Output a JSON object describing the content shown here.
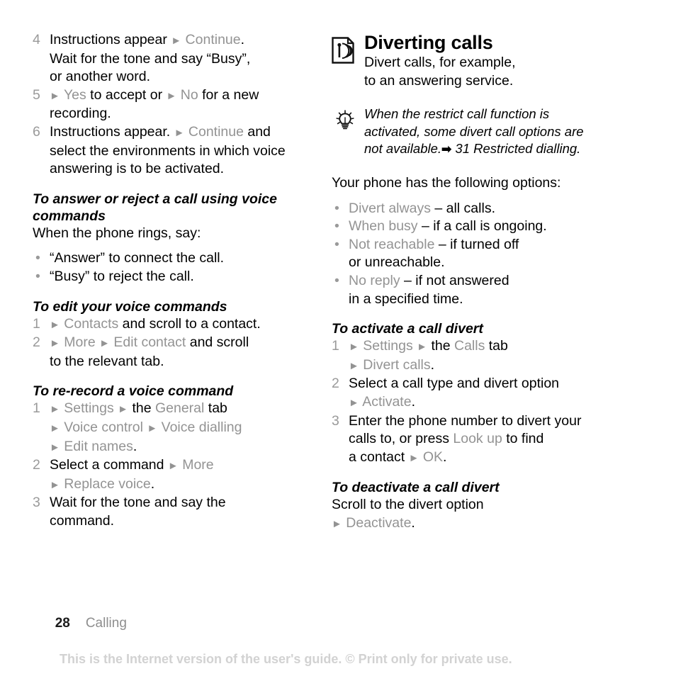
{
  "left_column": {
    "steps_top": [
      {
        "num": "4",
        "lines": [
          {
            "segments": [
              {
                "t": "Instructions appear ",
                "s": "plain"
              },
              {
                "t": "►",
                "s": "arrow"
              },
              {
                "t": " ",
                "s": "plain"
              },
              {
                "t": "Continue",
                "s": "ui"
              },
              {
                "t": ".",
                "s": "plain"
              }
            ]
          },
          {
            "segments": [
              {
                "t": "Wait for the tone and say “Busy”,",
                "s": "plain"
              }
            ]
          },
          {
            "segments": [
              {
                "t": "or another word.",
                "s": "plain"
              }
            ]
          }
        ]
      },
      {
        "num": "5",
        "lines": [
          {
            "segments": [
              {
                "t": "►",
                "s": "arrow"
              },
              {
                "t": " ",
                "s": "plain"
              },
              {
                "t": "Yes",
                "s": "ui"
              },
              {
                "t": " to accept or ",
                "s": "plain"
              },
              {
                "t": "►",
                "s": "arrow"
              },
              {
                "t": " ",
                "s": "plain"
              },
              {
                "t": "No",
                "s": "ui"
              },
              {
                "t": " for a new",
                "s": "plain"
              }
            ]
          },
          {
            "segments": [
              {
                "t": "recording.",
                "s": "plain"
              }
            ]
          }
        ]
      },
      {
        "num": "6",
        "lines": [
          {
            "segments": [
              {
                "t": "Instructions appear. ",
                "s": "plain"
              },
              {
                "t": "►",
                "s": "arrow"
              },
              {
                "t": " ",
                "s": "plain"
              },
              {
                "t": "Continue",
                "s": "ui"
              },
              {
                "t": " and",
                "s": "plain"
              }
            ]
          },
          {
            "segments": [
              {
                "t": "select the environments in which voice",
                "s": "plain"
              }
            ]
          },
          {
            "segments": [
              {
                "t": "answering is to be activated.",
                "s": "plain"
              }
            ]
          }
        ]
      }
    ],
    "heading_answer_reject": "To answer or reject a call using voice commands",
    "intro_rings": "When the phone rings, say:",
    "bullets_voice": [
      {
        "lines": [
          {
            "segments": [
              {
                "t": "“Answer” to connect the call.",
                "s": "plain"
              }
            ]
          }
        ]
      },
      {
        "lines": [
          {
            "segments": [
              {
                "t": "“Busy” to reject the call.",
                "s": "plain"
              }
            ]
          }
        ]
      }
    ],
    "heading_edit_commands": "To edit your voice commands",
    "steps_edit": [
      {
        "num": "1",
        "lines": [
          {
            "segments": [
              {
                "t": "►",
                "s": "arrow"
              },
              {
                "t": " ",
                "s": "plain"
              },
              {
                "t": "Contacts",
                "s": "ui"
              },
              {
                "t": " and scroll to a contact.",
                "s": "plain"
              }
            ]
          }
        ]
      },
      {
        "num": "2",
        "lines": [
          {
            "segments": [
              {
                "t": "►",
                "s": "arrow"
              },
              {
                "t": " ",
                "s": "plain"
              },
              {
                "t": "More",
                "s": "ui"
              },
              {
                "t": " ",
                "s": "plain"
              },
              {
                "t": "►",
                "s": "arrow"
              },
              {
                "t": " ",
                "s": "plain"
              },
              {
                "t": "Edit contact",
                "s": "ui"
              },
              {
                "t": " and scroll",
                "s": "plain"
              }
            ]
          },
          {
            "segments": [
              {
                "t": "to the relevant tab.",
                "s": "plain"
              }
            ]
          }
        ]
      }
    ],
    "heading_rerecord": "To re-record a voice command",
    "steps_rerecord": [
      {
        "num": "1",
        "lines": [
          {
            "segments": [
              {
                "t": "►",
                "s": "arrow"
              },
              {
                "t": " ",
                "s": "plain"
              },
              {
                "t": "Settings",
                "s": "ui"
              },
              {
                "t": " ",
                "s": "plain"
              },
              {
                "t": "►",
                "s": "arrow"
              },
              {
                "t": " the ",
                "s": "plain"
              },
              {
                "t": "General",
                "s": "ui"
              },
              {
                "t": " tab",
                "s": "plain"
              }
            ]
          },
          {
            "segments": [
              {
                "t": "►",
                "s": "arrow"
              },
              {
                "t": " ",
                "s": "plain"
              },
              {
                "t": "Voice control",
                "s": "ui"
              },
              {
                "t": " ",
                "s": "plain"
              },
              {
                "t": "►",
                "s": "arrow"
              },
              {
                "t": " ",
                "s": "plain"
              },
              {
                "t": "Voice dialling",
                "s": "ui"
              }
            ]
          },
          {
            "segments": [
              {
                "t": "►",
                "s": "arrow"
              },
              {
                "t": " ",
                "s": "plain"
              },
              {
                "t": "Edit names",
                "s": "ui"
              },
              {
                "t": ".",
                "s": "plain"
              }
            ]
          }
        ]
      },
      {
        "num": "2",
        "lines": [
          {
            "segments": [
              {
                "t": "Select a command ",
                "s": "plain"
              },
              {
                "t": "►",
                "s": "arrow"
              },
              {
                "t": " ",
                "s": "plain"
              },
              {
                "t": "More",
                "s": "ui"
              }
            ]
          },
          {
            "segments": [
              {
                "t": "►",
                "s": "arrow"
              },
              {
                "t": " ",
                "s": "plain"
              },
              {
                "t": "Replace voice",
                "s": "ui"
              },
              {
                "t": ".",
                "s": "plain"
              }
            ]
          }
        ]
      },
      {
        "num": "3",
        "lines": [
          {
            "segments": [
              {
                "t": "Wait for the tone and say the",
                "s": "plain"
              }
            ]
          },
          {
            "segments": [
              {
                "t": "command.",
                "s": "plain"
              }
            ]
          }
        ]
      }
    ]
  },
  "right_column": {
    "section_icon_name": "broadcast-page-icon",
    "section_title": "Diverting calls",
    "section_sub_lines": [
      "Divert calls, for example,",
      "to an answering service."
    ],
    "tip_icon_name": "lightbulb-tip-icon",
    "tip_lines": [
      {
        "segments": [
          {
            "t": "When the restrict call function is",
            "s": "plain"
          }
        ]
      },
      {
        "segments": [
          {
            "t": "activated, some divert call options are",
            "s": "plain"
          }
        ]
      },
      {
        "segments": [
          {
            "t": "not available.",
            "s": "plain"
          },
          {
            "t": "➡",
            "s": "solid-arrow"
          },
          {
            "t": " 31 Restricted dialling.",
            "s": "plain"
          }
        ]
      }
    ],
    "options_intro": "Your phone has the following options:",
    "option_bullets": [
      {
        "lines": [
          {
            "segments": [
              {
                "t": "Divert always",
                "s": "ui"
              },
              {
                "t": " – all calls.",
                "s": "plain"
              }
            ]
          }
        ]
      },
      {
        "lines": [
          {
            "segments": [
              {
                "t": "When busy",
                "s": "ui"
              },
              {
                "t": " – if a call is ongoing.",
                "s": "plain"
              }
            ]
          }
        ]
      },
      {
        "lines": [
          {
            "segments": [
              {
                "t": "Not reachable",
                "s": "ui"
              },
              {
                "t": " – if turned off",
                "s": "plain"
              }
            ]
          },
          {
            "segments": [
              {
                "t": "or unreachable.",
                "s": "plain"
              }
            ]
          }
        ]
      },
      {
        "lines": [
          {
            "segments": [
              {
                "t": "No reply",
                "s": "ui"
              },
              {
                "t": " – if not answered",
                "s": "plain"
              }
            ]
          },
          {
            "segments": [
              {
                "t": "in a specified time.",
                "s": "plain"
              }
            ]
          }
        ]
      }
    ],
    "heading_activate": "To activate a call divert",
    "steps_activate": [
      {
        "num": "1",
        "lines": [
          {
            "segments": [
              {
                "t": "►",
                "s": "arrow"
              },
              {
                "t": " ",
                "s": "plain"
              },
              {
                "t": "Settings",
                "s": "ui"
              },
              {
                "t": " ",
                "s": "plain"
              },
              {
                "t": "►",
                "s": "arrow"
              },
              {
                "t": " the ",
                "s": "plain"
              },
              {
                "t": "Calls",
                "s": "ui"
              },
              {
                "t": " tab",
                "s": "plain"
              }
            ]
          },
          {
            "segments": [
              {
                "t": "►",
                "s": "arrow"
              },
              {
                "t": " ",
                "s": "plain"
              },
              {
                "t": "Divert calls",
                "s": "ui"
              },
              {
                "t": ".",
                "s": "plain"
              }
            ]
          }
        ]
      },
      {
        "num": "2",
        "lines": [
          {
            "segments": [
              {
                "t": "Select a call type and divert option",
                "s": "plain"
              }
            ]
          },
          {
            "segments": [
              {
                "t": "►",
                "s": "arrow"
              },
              {
                "t": " ",
                "s": "plain"
              },
              {
                "t": "Activate",
                "s": "ui"
              },
              {
                "t": ".",
                "s": "plain"
              }
            ]
          }
        ]
      },
      {
        "num": "3",
        "lines": [
          {
            "segments": [
              {
                "t": "Enter the phone number to divert your",
                "s": "plain"
              }
            ]
          },
          {
            "segments": [
              {
                "t": "calls to, or press ",
                "s": "plain"
              },
              {
                "t": "Look up",
                "s": "ui"
              },
              {
                "t": " to find",
                "s": "plain"
              }
            ]
          },
          {
            "segments": [
              {
                "t": "a contact ",
                "s": "plain"
              },
              {
                "t": "►",
                "s": "arrow"
              },
              {
                "t": " ",
                "s": "plain"
              },
              {
                "t": "OK",
                "s": "ui"
              },
              {
                "t": ".",
                "s": "plain"
              }
            ]
          }
        ]
      }
    ],
    "heading_deactivate": "To deactivate a call divert",
    "deactivate_lines": [
      {
        "segments": [
          {
            "t": "Scroll to the divert option",
            "s": "plain"
          }
        ]
      },
      {
        "segments": [
          {
            "t": "►",
            "s": "arrow"
          },
          {
            "t": " ",
            "s": "plain"
          },
          {
            "t": "Deactivate",
            "s": "ui"
          },
          {
            "t": ".",
            "s": "plain"
          }
        ]
      }
    ]
  },
  "footer": {
    "page_number": "28",
    "chapter": "Calling",
    "watermark": "This is the Internet version of the user's guide. © Print only for private use."
  },
  "colors": {
    "text": "#000000",
    "ui_term_grey": "#939393",
    "step_number_grey": "#9a9a9a",
    "watermark_grey": "#d2d2d2",
    "chapter_grey": "#8e8e8e",
    "background": "#ffffff"
  }
}
